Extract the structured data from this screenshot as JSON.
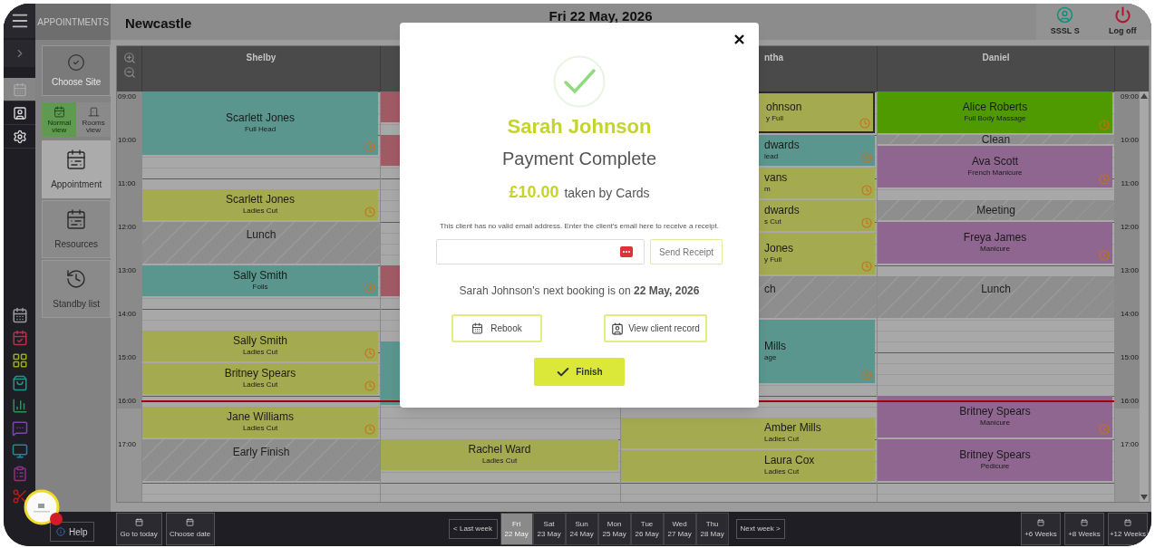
{
  "nav_rail": [
    {
      "kind": "calendar",
      "selected": true
    },
    {
      "kind": "contacts",
      "selected": false
    },
    {
      "kind": "settings",
      "selected": false
    }
  ],
  "sidebar": {
    "title": "APPOINTMENTS",
    "site_button": "Choose Site",
    "views": [
      {
        "label": "Normal view",
        "kind": "normal",
        "selected": true
      },
      {
        "label": "Rooms view",
        "kind": "rooms",
        "selected": false
      }
    ],
    "menu": [
      {
        "label": "Appointment",
        "kind": "appointment",
        "selected": true
      },
      {
        "label": "Resources",
        "kind": "resources",
        "selected": false
      },
      {
        "label": "Standby list",
        "kind": "standby",
        "selected": false
      }
    ]
  },
  "header": {
    "site": "Newcastle",
    "date": "Fri 22 May, 2026",
    "user": "SSSL S",
    "log_off": "Log off"
  },
  "calendar": {
    "time_labels_left": [
      "09:00",
      "10:00",
      "11:00",
      "12:00",
      "13:00",
      "14:00",
      "15:00",
      "16:00",
      "17:00"
    ],
    "time_labels_right": [
      "09:00",
      "10:00",
      "11:00",
      "12:00",
      "13:00",
      "14:00",
      "15:00",
      "16:00",
      "17:00"
    ],
    "columns": [
      {
        "name": "Shelby",
        "appointments": [
          {
            "kind": "booking",
            "client": "Scarlett Jones",
            "service": "Full Head",
            "color": "#5a968e",
            "reminder": true,
            "selected": false
          },
          {
            "kind": "booking",
            "client": "Scarlett Jones",
            "service": "Ladies Cut",
            "color": "#a4aa50",
            "reminder": true,
            "selected": false
          },
          {
            "kind": "break",
            "label": "Lunch"
          },
          {
            "kind": "booking",
            "client": "Sally Smith",
            "service": "Foils",
            "color": "#5a968e",
            "reminder": true,
            "selected": false
          },
          {
            "kind": "booking",
            "client": "Sally Smith",
            "service": "Ladies Cut",
            "color": "#a4aa50",
            "reminder": true,
            "selected": false
          },
          {
            "kind": "booking",
            "client": "Britney Spears",
            "service": "Ladies Cut",
            "color": "#a4aa50",
            "reminder": true,
            "selected": false
          },
          {
            "kind": "booking",
            "client": "Jane Williams",
            "service": "Ladies Cut",
            "color": "#a4aa50",
            "reminder": true,
            "selected": false
          },
          {
            "kind": "break",
            "label": "Early Finish"
          }
        ]
      },
      {
        "appointments": [
          {
            "kind": "booking",
            "color": "#a05a64",
            "selected": false
          },
          {
            "kind": "booking",
            "color": "#a05a64",
            "selected": false
          },
          {
            "kind": "booking",
            "color": "#a05a64",
            "selected": false
          },
          {
            "kind": "booking",
            "color": "#5a968e",
            "selected": false
          },
          {
            "kind": "booking",
            "client": "Rachel Ward",
            "service": "Ladies Cut",
            "color": "#a4aa50",
            "reminder": false,
            "selected": false
          }
        ]
      },
      {
        "name": "ntha",
        "appointments": [
          {
            "kind": "booking",
            "client": "ohnson",
            "service": "y Full",
            "color": "#a4aa50",
            "reminder": true,
            "selected": true
          },
          {
            "kind": "booking",
            "client": "dwards",
            "service": "lead",
            "color": "#5a968e",
            "reminder": true,
            "selected": false
          },
          {
            "kind": "booking",
            "client": "vans",
            "service": "m",
            "color": "#a4aa50",
            "reminder": true,
            "selected": false
          },
          {
            "kind": "booking",
            "client": "dwards",
            "service": "s Cut",
            "color": "#a4aa50",
            "reminder": true,
            "selected": false
          },
          {
            "kind": "booking",
            "client": "Jones",
            "service": "y Full",
            "color": "#a4aa50",
            "reminder": true,
            "selected": false
          },
          {
            "kind": "break",
            "label": "ch"
          },
          {
            "kind": "booking",
            "client": "Mills",
            "service": "age",
            "color": "#5a968e",
            "reminder": true,
            "selected": false
          },
          {
            "kind": "booking",
            "client": "Amber Mills",
            "service": "Ladies Cut",
            "color": "#a4aa50",
            "reminder": false,
            "selected": false
          },
          {
            "kind": "booking",
            "client": "Laura Cox",
            "service": "Ladies Cut",
            "color": "#a4aa50",
            "reminder": false,
            "selected": false
          }
        ]
      },
      {
        "name": "Daniel",
        "appointments": [
          {
            "kind": "booking",
            "client": "Alice Roberts",
            "service": "Full Body Massage",
            "color": "#4e9a00",
            "reminder": true,
            "selected": false
          },
          {
            "kind": "break",
            "label": "Clean"
          },
          {
            "kind": "booking",
            "client": "Ava Scott",
            "service": "French Manicure",
            "color": "#8e6690",
            "reminder": true,
            "selected": false
          },
          {
            "kind": "break",
            "label": "Meeting"
          },
          {
            "kind": "booking",
            "client": "Freya James",
            "service": "Manicure",
            "color": "#8e6690",
            "reminder": true,
            "selected": false
          },
          {
            "kind": "break",
            "label": "Lunch"
          },
          {
            "kind": "booking",
            "client": "Britney Spears",
            "service": "Manicure",
            "color": "#8e6690",
            "reminder": true,
            "selected": false
          },
          {
            "kind": "booking",
            "client": "Britney Spears",
            "service": "Pedicure",
            "color": "#8e6690",
            "reminder": false,
            "selected": false
          }
        ]
      }
    ]
  },
  "payment_dialog": {
    "client": "Sarah Johnson",
    "title": "Payment Complete",
    "amount": "£10.00",
    "method": "taken by Cards",
    "email_note": "This client has no valid email address. Enter the client's email here to receive a receipt.",
    "send_button": "Send Receipt",
    "next_booking": "Sarah Johnson's next booking is on **22 May, 2026**",
    "rebook_button": "Rebook",
    "record_button": "View client record",
    "finish_button": "Finish"
  },
  "bottom_bar": {
    "help": "Help",
    "go_today": "Go to today",
    "choose_date": "Choose date",
    "last_week": "< Last week",
    "next_week": "Next week >",
    "days": [
      {
        "day": "Fri",
        "date": "22 May",
        "selected": true
      },
      {
        "day": "Sat",
        "date": "23 May",
        "selected": false
      },
      {
        "day": "Sun",
        "date": "24 May",
        "selected": false
      },
      {
        "day": "Mon",
        "date": "25 May",
        "selected": false
      },
      {
        "day": "Tue",
        "date": "26 May",
        "selected": false
      },
      {
        "day": "Wed",
        "date": "27 May",
        "selected": false
      },
      {
        "day": "Thu",
        "date": "28 May",
        "selected": false
      }
    ],
    "jumps": [
      "+6 Weeks",
      "+8 Weeks",
      "+12 Weeks"
    ]
  }
}
